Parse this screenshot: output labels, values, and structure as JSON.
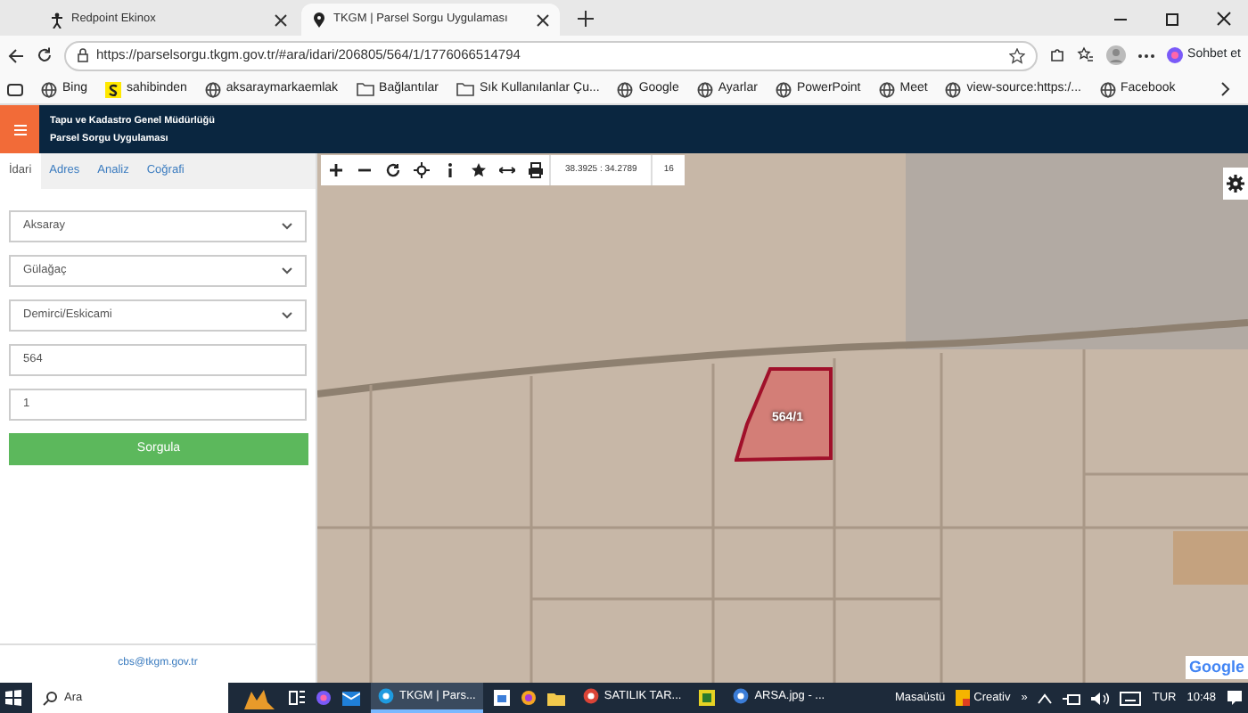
{
  "browser": {
    "tabs": [
      {
        "title": "Redpoint Ekinox",
        "selected": false
      },
      {
        "title": "TKGM | Parsel Sorgu Uygulaması",
        "selected": true
      }
    ],
    "url": "https://parselsorgu.tkgm.gov.tr/#ara/idari/206805/564/1/1776066514794",
    "profile_button": "Sohbet et",
    "bookmarks": [
      {
        "label": "Bing",
        "kind": "globe"
      },
      {
        "label": "sahibinden",
        "kind": "s"
      },
      {
        "label": "aksaraymarkaemlak",
        "kind": "globe"
      },
      {
        "label": "Bağlantılar",
        "kind": "folder"
      },
      {
        "label": "Sık Kullanılanlar Çu...",
        "kind": "folder"
      },
      {
        "label": "Google",
        "kind": "globe"
      },
      {
        "label": "Ayarlar",
        "kind": "globe"
      },
      {
        "label": "PowerPoint",
        "kind": "globe"
      },
      {
        "label": "Meet",
        "kind": "globe"
      },
      {
        "label": "view-source:https:/...",
        "kind": "globe"
      },
      {
        "label": "Facebook",
        "kind": "globe"
      }
    ]
  },
  "app": {
    "title_line_1": "Tapu ve Kadastro Genel Müdürlüğü",
    "title_line_2": "Parsel Sorgu Uygulaması",
    "sidebar": {
      "tabs": [
        {
          "label": "İdari",
          "selected": true
        },
        {
          "label": "Adres",
          "selected": false
        },
        {
          "label": "Analiz",
          "selected": false
        },
        {
          "label": "Coğrafi",
          "selected": false
        }
      ],
      "fields": [
        {
          "kind": "select",
          "value": "Aksaray"
        },
        {
          "kind": "select",
          "value": "Gülağaç"
        },
        {
          "kind": "select",
          "value": "Demirci/Eskicami"
        },
        {
          "kind": "input",
          "value": "564"
        },
        {
          "kind": "input",
          "value": "1"
        }
      ],
      "submit_button": "Sorgula",
      "footer_email": "cbs@tkgm.gov.tr"
    },
    "map": {
      "toolbar": {
        "tools": [
          {
            "kind": "zoom-in"
          },
          {
            "kind": "zoom-out"
          },
          {
            "kind": "refresh"
          },
          {
            "kind": "locate"
          },
          {
            "kind": "info"
          },
          {
            "kind": "star"
          },
          {
            "kind": "measure"
          },
          {
            "kind": "print"
          }
        ],
        "coordinates": "38.3925 : 34.2789",
        "zoom_level": "16"
      },
      "parcel_label": "564/1",
      "attribution": "Google"
    }
  },
  "taskbar": {
    "search_placeholder": "Ara",
    "items": [
      {
        "label": "TKGM | Pars...",
        "kind": "edge",
        "active": true
      },
      {
        "label": "SATILIK TAR...",
        "kind": "chrome",
        "active": false
      },
      {
        "label": "ARSA.jpg - ...",
        "kind": "photos",
        "active": false
      }
    ],
    "desktop_label": "Masaüstü",
    "creative_label": "Creativ",
    "overflow": "»",
    "language": "TUR",
    "time": "10:48"
  }
}
